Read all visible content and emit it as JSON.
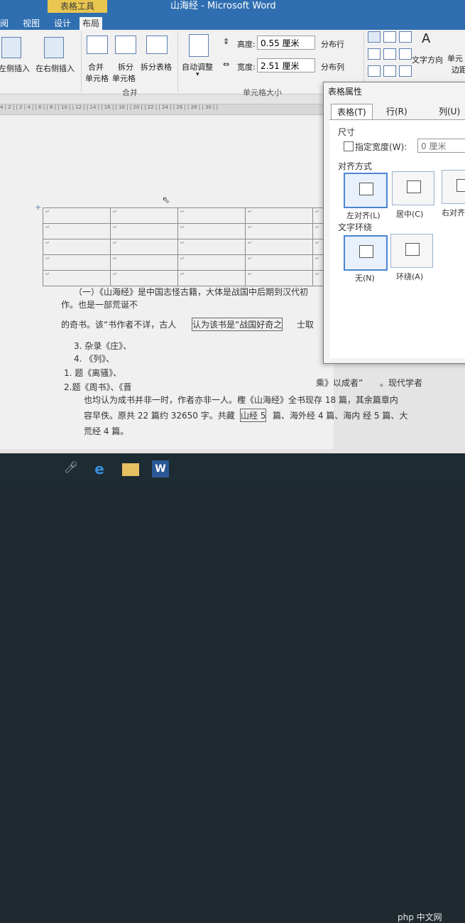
{
  "window": {
    "title": "山海经 - Microsoft Word",
    "context_tab": "表格工具"
  },
  "tabs": [
    {
      "label": "阅"
    },
    {
      "label": "视图"
    },
    {
      "label": "设计"
    },
    {
      "label": "布局",
      "active": true
    }
  ],
  "ribbon": {
    "insert_left": "左侧插入",
    "insert_right": "在右侧插入",
    "merge_cells": "合并",
    "merge_cells2": "单元格",
    "split_cells": "拆分",
    "split_cells2": "单元格",
    "split_table": "拆分表格",
    "group_merge": "合并",
    "autofit": "自动调整",
    "height_label": "高度:",
    "height_value": "0.55 厘米",
    "width_label": "宽度:",
    "width_value": "2.51 厘米",
    "group_cellsize": "单元格大小",
    "distribute_rows": "分布行",
    "distribute_cols": "分布列",
    "text_direction": "文字方向",
    "cell_margin": "单元",
    "cell_margin2": "边距"
  },
  "ruler": "4 | 2 |    | 2 | 4 |   | 6 |   | 8 |   | 10 |   | 12 |   | 14 |   | 16 |   | 18 |   | 20 |   | 22 |   | 24 |   | 26 |   | 28 |   | 30 |   |",
  "document": {
    "line1": "（一）《山海经》是中国志怪古籍，大体是战国中后期到汉代初",
    "line2": "作。也是一部荒诞不",
    "line3a": "的奇书。该“书作者不详，古人",
    "line3b": "认为该书是“战国好奇之",
    "line3c": "士取",
    "line4": "3.   杂录《庄》、",
    "line5": "4.   《列》、",
    "line6": "1. 题《离骚》、",
    "line7a": "2.题《周书》、《晋",
    "line7b": "乘》以成者”",
    "line7c": "。现代学者",
    "line8": "也均认为成书并非一时，作者亦非一人。檉《山海经》全书现存 18 篇，其余篇章内",
    "line9": "容早佚。原共 22 篇约 32650 字。共藏",
    "line9b": "山经 5",
    "line9c": "篇、海外经 4 篇、海内 经 5 篇、大",
    "line10": "荒经 4 篇。"
  },
  "dialog": {
    "title": "表格属性",
    "tabs": [
      "表格(T)",
      "行(R)",
      "列(U)"
    ],
    "size_label": "尺寸",
    "pref_width": "指定宽度(W):",
    "pref_width_value": "0 厘米",
    "align_label": "对齐方式",
    "align_left": "左对齐(L)",
    "align_center": "居中(C)",
    "align_right": "右对齐",
    "wrap_label": "文字环绕",
    "wrap_none": "无(N)",
    "wrap_around": "环绕(A)"
  },
  "watermark": "php 中文网"
}
